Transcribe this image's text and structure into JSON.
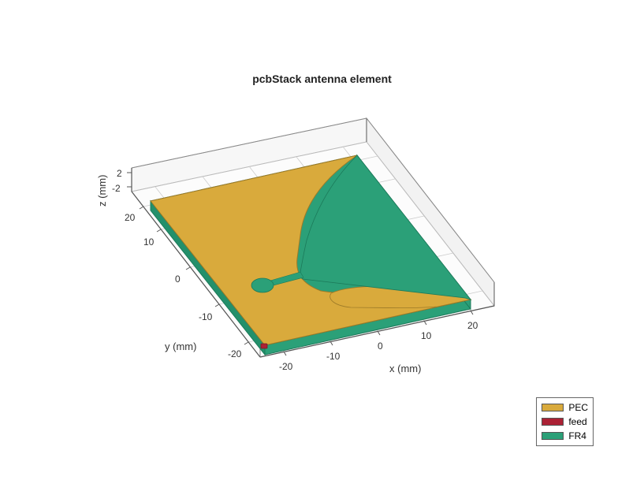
{
  "chart_data": {
    "type": "surface3d",
    "title": "pcbStack antenna element",
    "axes": {
      "x": {
        "label": "x (mm)",
        "ticks": [
          -20,
          -10,
          0,
          10,
          20
        ],
        "range": [
          -25,
          25
        ]
      },
      "y": {
        "label": "y (mm)",
        "ticks": [
          -20,
          -10,
          0,
          10,
          20
        ],
        "range": [
          -22,
          22
        ]
      },
      "z": {
        "label": "z (mm)",
        "ticks": [
          -2,
          2
        ],
        "range": [
          -3,
          3
        ]
      }
    },
    "legend": [
      {
        "name": "PEC",
        "color": "#d9aa3c"
      },
      {
        "name": "feed",
        "color": "#ab2135"
      },
      {
        "name": "FR4",
        "color": "#2ba078"
      }
    ],
    "description": "3D isometric view of a rectangular PCB antenna stack (~44x44 mm, thin board ~|z|<2 mm). Top PEC layer (gold) covers most of the board with a tapered cutout exposing FR4 dielectric (teal) forming a curved wedge from right side tapering to a narrow feed line and small circular via/pad near center. FR4 substrate visible at edges. A small red feed marker is on the front (-y) edge near x=0."
  },
  "title": "pcbStack antenna element",
  "xlabel": "x (mm)",
  "ylabel": "y (mm)",
  "zlabel": "z (mm)",
  "xticks": {
    "t0": "-20",
    "t1": "-10",
    "t2": "0",
    "t3": "10",
    "t4": "20"
  },
  "yticks": {
    "t0": "-20",
    "t1": "-10",
    "t2": "0",
    "t3": "10",
    "t4": "20"
  },
  "zticks": {
    "t0": "-2",
    "t1": "2"
  },
  "legend": {
    "pec": "PEC",
    "feed": "feed",
    "fr4": "FR4"
  },
  "colors": {
    "pec": "#d9aa3c",
    "feed": "#ab2135",
    "fr4": "#2ba078",
    "edge": "#555555",
    "grid": "#cccccc",
    "box": "#555555"
  }
}
